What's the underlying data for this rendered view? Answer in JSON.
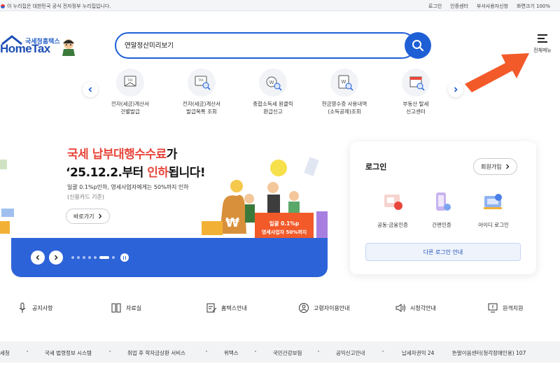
{
  "topbar": {
    "gov_notice": "이 누리집은 대한민국 공식 전자정부 누리집입니다.",
    "links": [
      "로그인",
      "인증센터",
      "부서사용자신청",
      "화면크기 100%"
    ]
  },
  "header": {
    "logo_sub": "국세청홈택스",
    "logo_main": "HomeTax",
    "search_value": "연말정산미리보기",
    "all_menu_label": "전체메뉴"
  },
  "quick_menu": [
    {
      "label": "전자(세금)계산서\n건별발급",
      "icon": "tax-invoice-icon"
    },
    {
      "label": "전자(세금)계산서\n발급목록 조회",
      "icon": "invoice-search-icon"
    },
    {
      "label": "종합소득세 원클릭\n환급신고",
      "icon": "won-refund-icon"
    },
    {
      "label": "현금영수증 사용내역\n(소득공제)조회",
      "icon": "receipt-search-icon"
    },
    {
      "label": "부동산 탈세\n신고센터",
      "icon": "store-report-icon"
    }
  ],
  "banner": {
    "title1_prefix": "국세 ",
    "title1_highlight": "납부대행수수료",
    "title1_suffix": "가",
    "title2_prefix": "‘25.12.2.부터 ",
    "title2_highlight": "인하",
    "title2_suffix": "됩니다!",
    "desc1": "일괄 0.1%p인하, 영세사업자에게는 50%까지 인하",
    "desc2": "(신용카드 기준)",
    "more_label": "바로가기",
    "graphic_line1": "일괄 0.1%p",
    "graphic_line2": "영세사업자 50%까지",
    "slide_count": 7,
    "active_slide": 6
  },
  "login": {
    "title": "로그인",
    "join_label": "회원가입",
    "options": [
      "공동·금융인증",
      "간편인증",
      "아이디 로그인"
    ],
    "other_label": "다른 로그인 안내"
  },
  "quick_links": [
    {
      "label": "공지사항",
      "icon": "microphone-icon"
    },
    {
      "label": "자료실",
      "icon": "archive-icon"
    },
    {
      "label": "홈택스안내",
      "icon": "document-pen-icon"
    },
    {
      "label": "고령자이용안내",
      "icon": "elderly-icon"
    },
    {
      "label": "시청각안내",
      "icon": "speaker-icon"
    },
    {
      "label": "원격지원",
      "icon": "remote-support-icon"
    }
  ],
  "related_sites": [
    "세청",
    "국세 법령정보 시스템",
    "취업 후 학자금상환 서비스",
    "위택스",
    "국민건강보험",
    "공익신고안내",
    "납세자권익 24",
    "손말이음센터(청각장애인용) 107"
  ],
  "colors": {
    "brand_blue": "#1f5fd6",
    "banner_blue": "#2d63d8",
    "highlight_red": "#e8463b",
    "arrow_orange": "#f25a2a"
  }
}
